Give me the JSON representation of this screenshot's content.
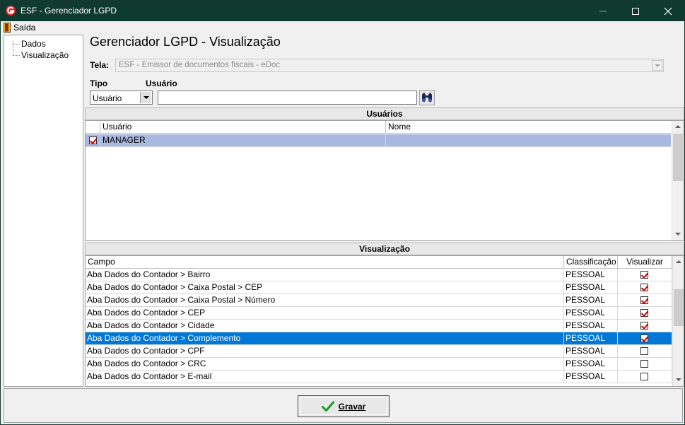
{
  "window": {
    "title": "ESF - Gerenciador LGPD"
  },
  "menu": {
    "exit_label": "Saída"
  },
  "tree": {
    "items": [
      "Dados",
      "Visualização"
    ]
  },
  "page": {
    "title": "Gerenciador LGPD - Visualização"
  },
  "form": {
    "tela_label": "Tela:",
    "tela_value": "ESF - Emissor de documentos fiscais - eDoc",
    "tipo_label": "Tipo",
    "tipo_value": "Usuário",
    "usuario_label": "Usuário",
    "usuario_value": ""
  },
  "users_section": {
    "header": "Usuários",
    "columns": [
      "Usuário",
      "Nome"
    ],
    "rows": [
      {
        "checked": true,
        "usuario": "MANAGER",
        "nome": ""
      }
    ]
  },
  "view_section": {
    "header": "Visualização",
    "columns": [
      "Campo",
      "Classificação",
      "Visualizar"
    ],
    "rows": [
      {
        "campo": "Aba Dados do Contador > Bairro",
        "classificacao": "PESSOAL",
        "visualizar": true
      },
      {
        "campo": "Aba Dados do Contador > Caixa Postal > CEP",
        "classificacao": "PESSOAL",
        "visualizar": true
      },
      {
        "campo": "Aba Dados do Contador > Caixa Postal > Número",
        "classificacao": "PESSOAL",
        "visualizar": true
      },
      {
        "campo": "Aba Dados do Contador > CEP",
        "classificacao": "PESSOAL",
        "visualizar": true
      },
      {
        "campo": "Aba Dados do Contador > Cidade",
        "classificacao": "PESSOAL",
        "visualizar": true
      },
      {
        "campo": "Aba Dados do Contador > Complemento",
        "classificacao": "PESSOAL",
        "visualizar": true,
        "selected": true
      },
      {
        "campo": "Aba Dados do Contador > CPF",
        "classificacao": "PESSOAL",
        "visualizar": false
      },
      {
        "campo": "Aba Dados do Contador > CRC",
        "classificacao": "PESSOAL",
        "visualizar": false
      },
      {
        "campo": "Aba Dados do Contador > E-mail",
        "classificacao": "PESSOAL",
        "visualizar": false
      }
    ]
  },
  "footer": {
    "save_label": "Gravar"
  },
  "colors": {
    "titlebar": "#0f3a2f",
    "selection": "#0078d7",
    "user_selection": "#a8b8e0",
    "check": "#d40000"
  }
}
